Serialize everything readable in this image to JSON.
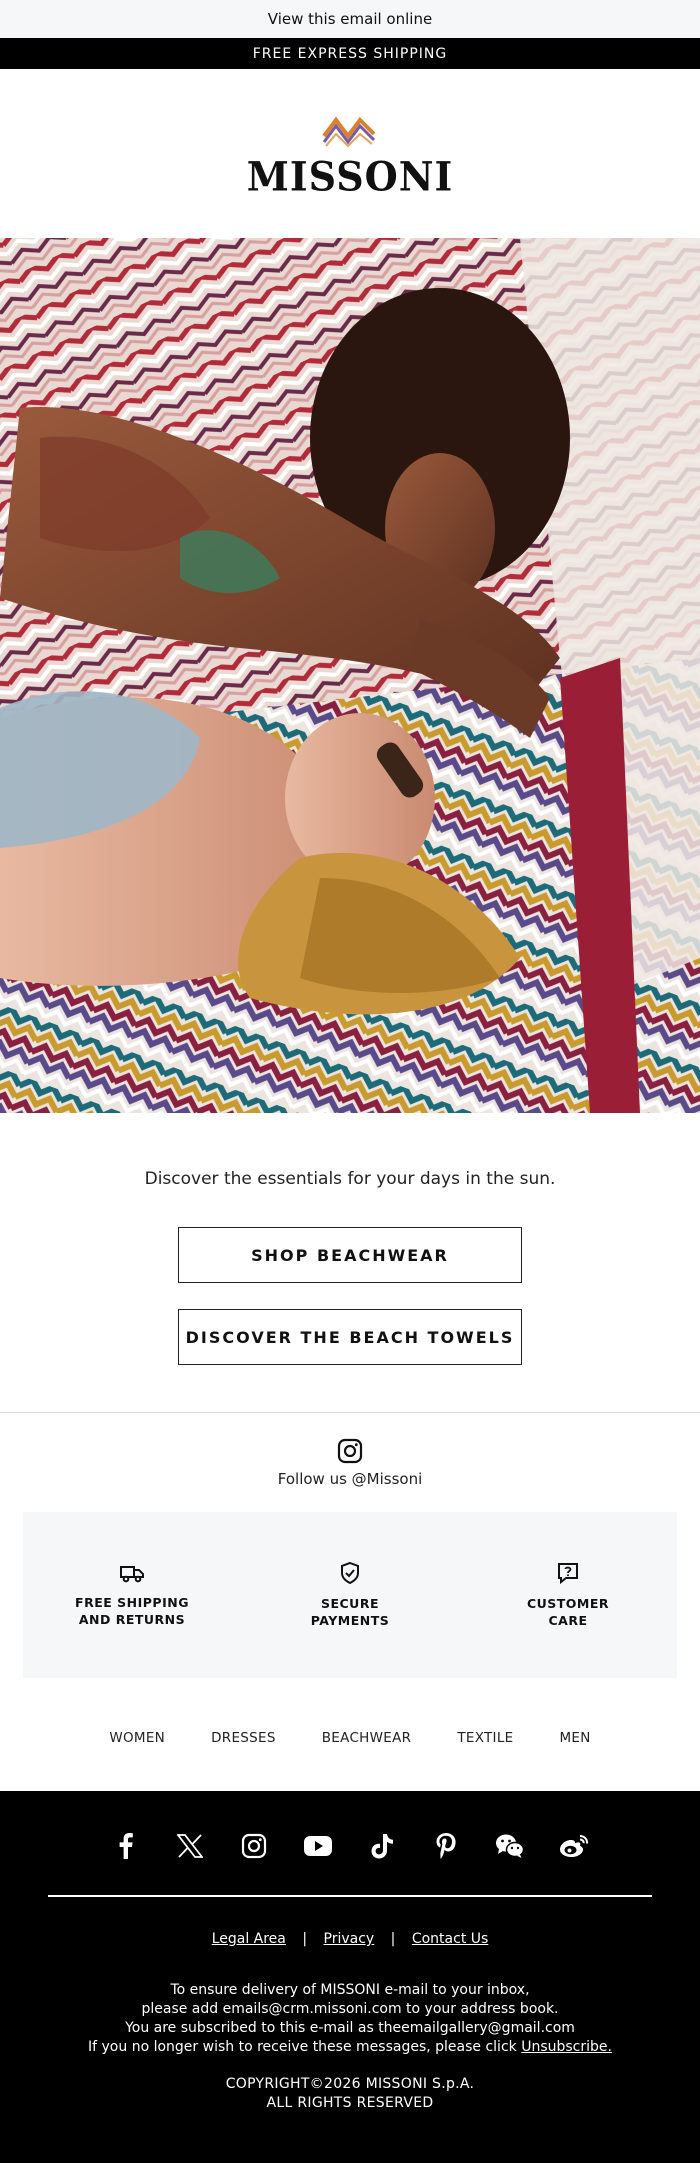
{
  "header": {
    "view_online": "View this email online",
    "shipping_banner": "FREE EXPRESS SHIPPING"
  },
  "brand": {
    "name": "MISSONI"
  },
  "main": {
    "tagline": "Discover the essentials for your days in the sun.",
    "buttons": [
      {
        "label": "SHOP BEACHWEAR"
      },
      {
        "label": "DISCOVER THE BEACH TOWELS"
      }
    ],
    "follow_text": "Follow us @Missoni"
  },
  "services": [
    {
      "icon": "truck-icon",
      "line1": "FREE SHIPPING",
      "line2": "AND RETURNS"
    },
    {
      "icon": "shield-check-icon",
      "line1": "SECURE",
      "line2": "PAYMENTS"
    },
    {
      "icon": "question-chat-icon",
      "line1": "CUSTOMER",
      "line2": "CARE"
    }
  ],
  "nav": [
    "WOMEN",
    "DRESSES",
    "BEACHWEAR",
    "TEXTILE",
    "MEN"
  ],
  "footer": {
    "social": [
      "facebook-icon",
      "x-icon",
      "instagram-icon",
      "youtube-icon",
      "tiktok-icon",
      "pinterest-icon",
      "wechat-icon",
      "weibo-icon"
    ],
    "links": [
      "Legal Area",
      "Privacy",
      "Contact Us"
    ],
    "separator": "|",
    "notice_line1": "To ensure delivery of MISSONI e-mail to your inbox,",
    "notice_line2": "please add emails@crm.missoni.com to your address book.",
    "notice_line3": "You are subscribed to this e-mail as theemailgallery@gmail.com",
    "notice_line4": "If you no longer wish to receive these messages, please click",
    "unsubscribe": "Unsubscribe.",
    "copyright_line1": "COPYRIGHT©2026 MISSONI S.p.A.",
    "copyright_line2": "ALL RIGHTS RESERVED"
  },
  "colors": {
    "footer_bg": "#000000",
    "panel_bg": "#f6f7f9",
    "logo_orange": "#d9822b",
    "logo_purple": "#7a5aa6"
  }
}
